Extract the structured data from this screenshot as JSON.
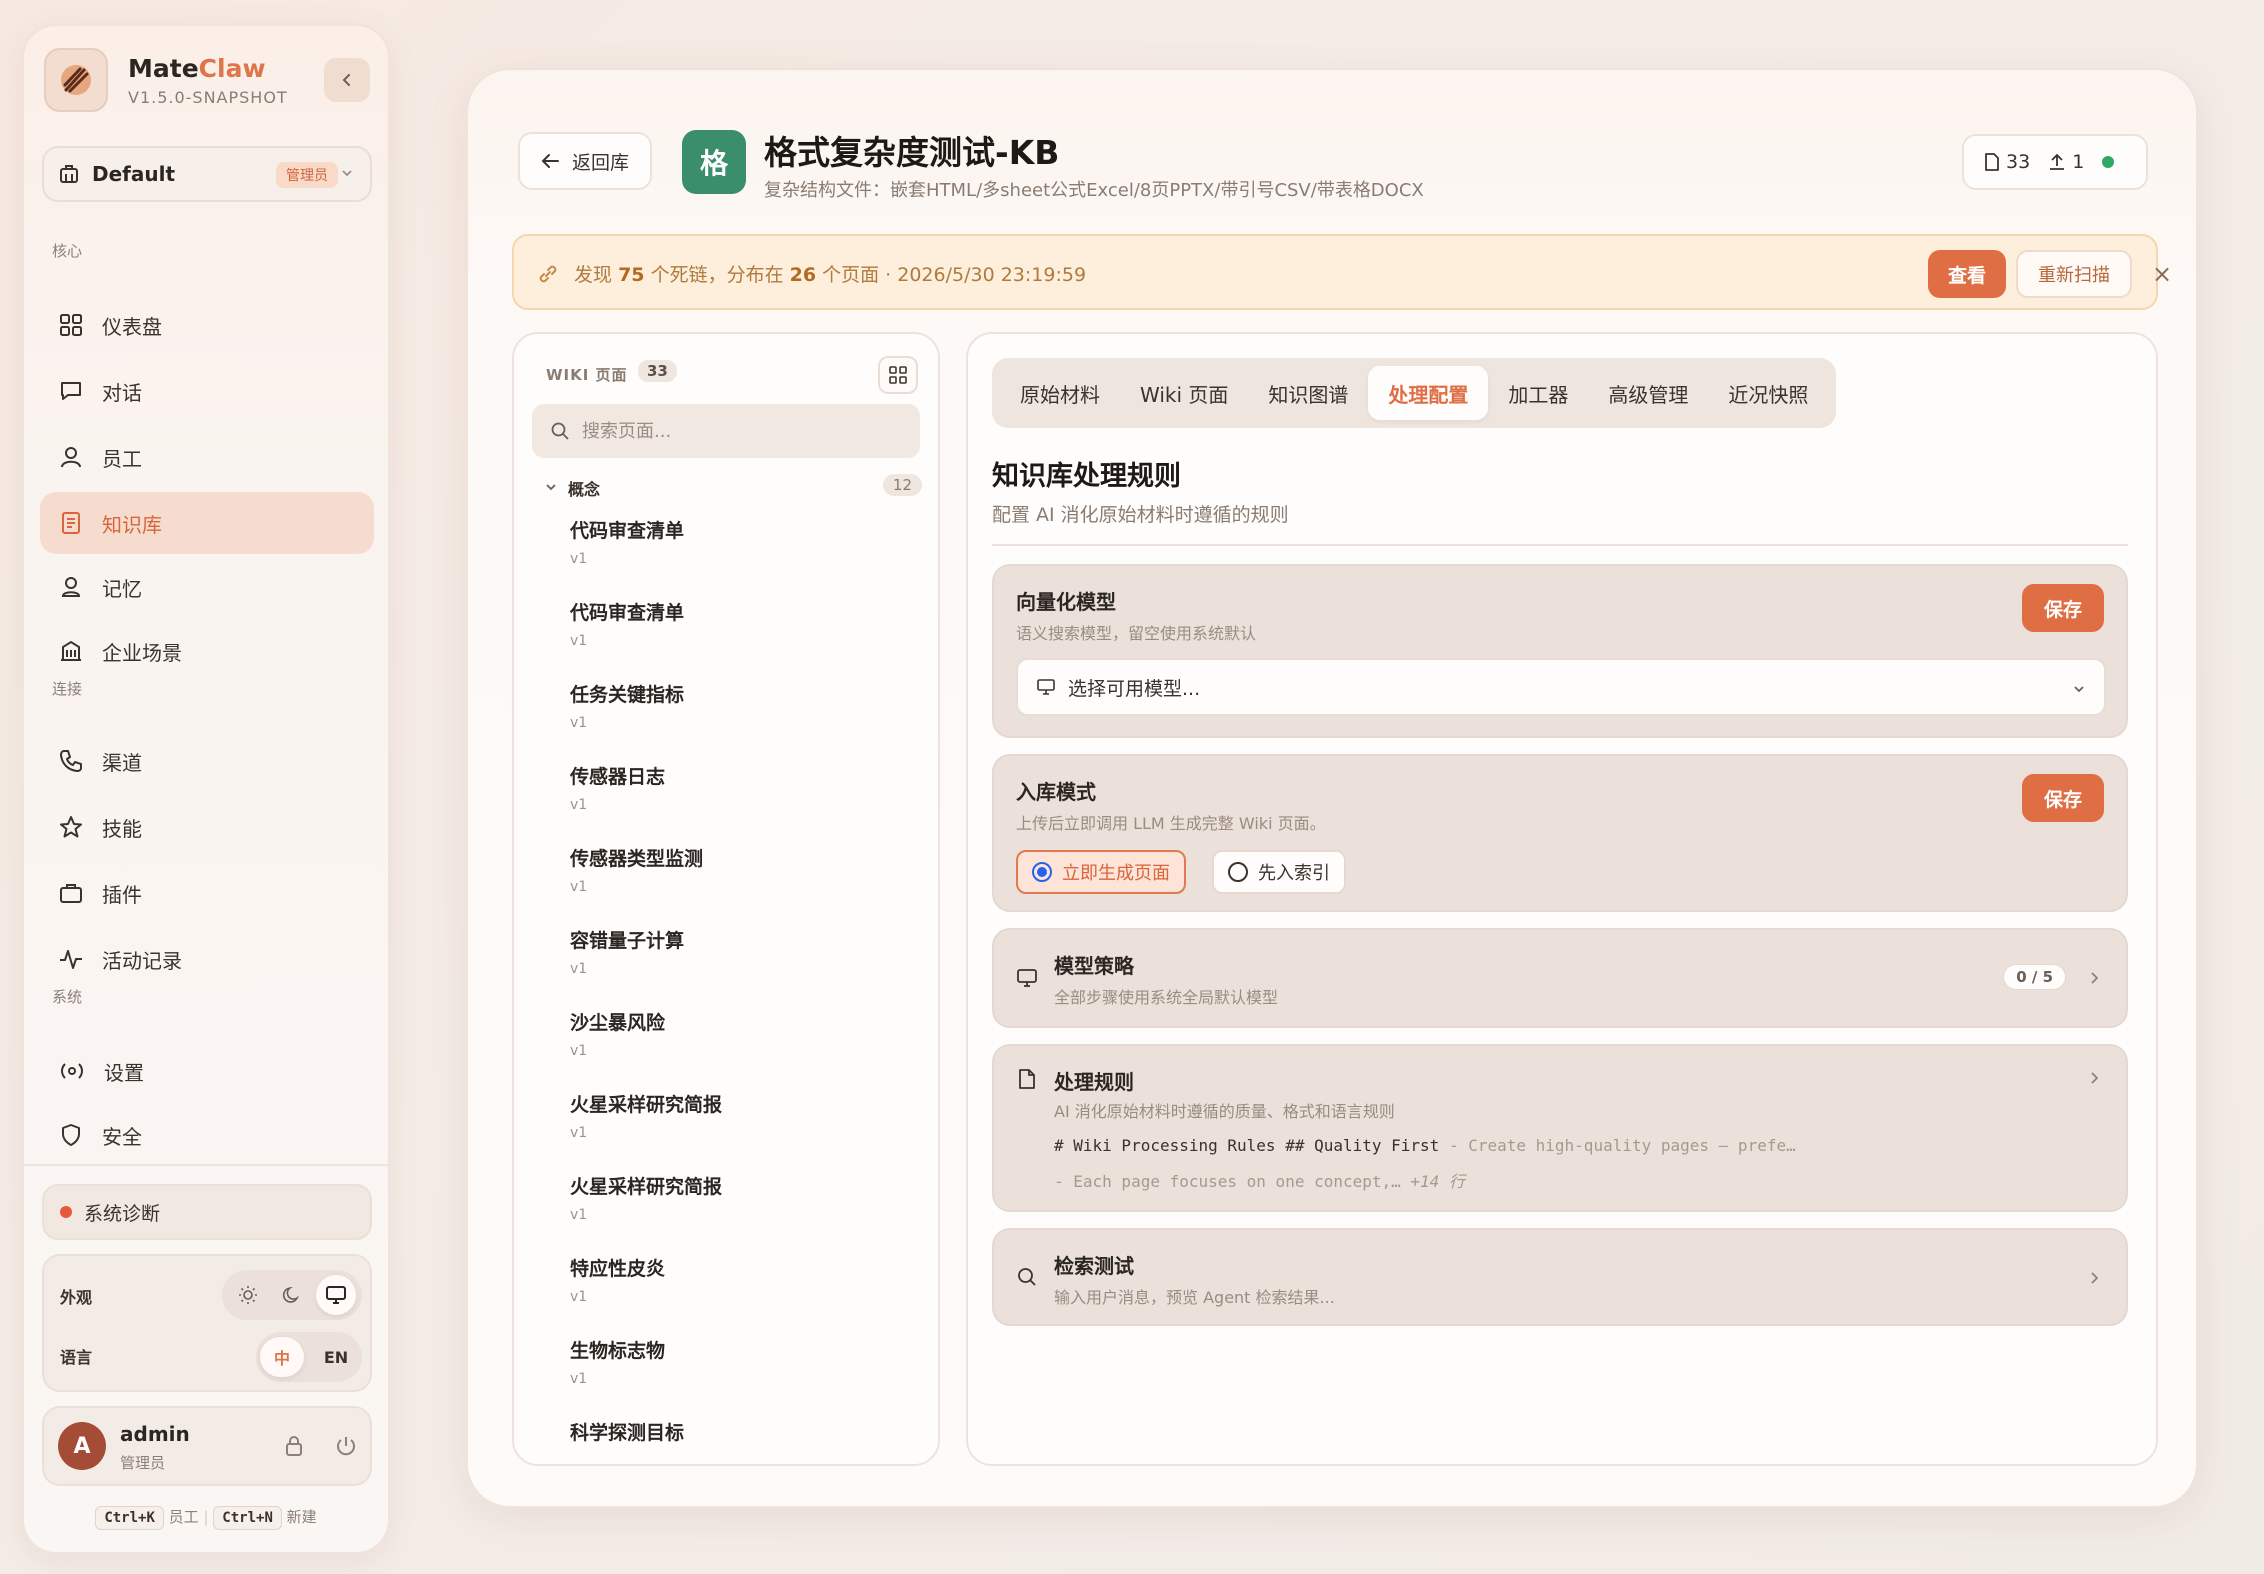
{
  "sidebar": {
    "brand_part1": "Mate",
    "brand_part2": "Claw",
    "version": "V1.5.0-SNAPSHOT",
    "workspace": {
      "name": "Default",
      "badge": "管理员"
    },
    "sections": {
      "core": "核心",
      "connect": "连接",
      "system": "系统"
    },
    "items": [
      {
        "label": "仪表盘",
        "icon": "grid-icon"
      },
      {
        "label": "对话",
        "icon": "chat-icon"
      },
      {
        "label": "员工",
        "icon": "user-icon"
      },
      {
        "label": "知识库",
        "icon": "document-icon",
        "active": true
      },
      {
        "label": "记忆",
        "icon": "memory-icon"
      },
      {
        "label": "企业场景",
        "icon": "building-icon"
      },
      {
        "label": "渠道",
        "icon": "phone-icon"
      },
      {
        "label": "技能",
        "icon": "star-icon"
      },
      {
        "label": "插件",
        "icon": "briefcase-icon"
      },
      {
        "label": "活动记录",
        "icon": "activity-icon"
      },
      {
        "label": "设置",
        "icon": "settings-icon"
      },
      {
        "label": "安全",
        "icon": "shield-icon"
      }
    ],
    "diagnostics": "系统诊断",
    "appearance_label": "外观",
    "language_label": "语言",
    "lang_zh": "中",
    "lang_en": "EN",
    "user": {
      "initial": "A",
      "name": "admin",
      "role": "管理员"
    },
    "shortcuts": [
      {
        "key": "Ctrl+K",
        "label": "员工"
      },
      {
        "key": "Ctrl+N",
        "label": "新建"
      }
    ]
  },
  "header": {
    "back_label": "返回库",
    "kb_initial": "格",
    "kb_title": "格式复杂度测试-KB",
    "kb_subtitle": "复杂结构文件：嵌套HTML/多sheet公式Excel/8页PPTX/带引号CSV/带表格DOCX",
    "stats": {
      "pages": "33",
      "uploads": "1"
    }
  },
  "alert": {
    "prefix": "发现",
    "dead_links": "75",
    "mid": "个死链，分布在",
    "pages": "26",
    "suffix": "个页面 · 2026/5/30 23:19:59",
    "view_label": "查看",
    "rescan_label": "重新扫描",
    "close": "×"
  },
  "wiki": {
    "heading": "WIKI 页面",
    "count": "33",
    "search_placeholder": "搜索页面...",
    "category": {
      "label": "概念",
      "count": "12"
    },
    "items": [
      {
        "title": "代码审查清单",
        "version": "v1"
      },
      {
        "title": "代码审查清单",
        "version": "v1"
      },
      {
        "title": "任务关键指标",
        "version": "v1"
      },
      {
        "title": "传感器日志",
        "version": "v1"
      },
      {
        "title": "传感器类型监测",
        "version": "v1"
      },
      {
        "title": "容错量子计算",
        "version": "v1"
      },
      {
        "title": "沙尘暴风险",
        "version": "v1"
      },
      {
        "title": "火星采样研究简报",
        "version": "v1"
      },
      {
        "title": "火星采样研究简报",
        "version": "v1"
      },
      {
        "title": "特应性皮炎",
        "version": "v1"
      },
      {
        "title": "生物标志物",
        "version": "v1"
      },
      {
        "title": "科学探测目标",
        "version": ""
      }
    ]
  },
  "config": {
    "tabs": [
      "原始材料",
      "Wiki 页面",
      "知识图谱",
      "处理配置",
      "加工器",
      "高级管理",
      "近况快照"
    ],
    "active_tab": 3,
    "title": "知识库处理规则",
    "subtitle": "配置 AI 消化原始材料时遵循的规则",
    "save_label": "保存",
    "vector": {
      "title": "向量化模型",
      "desc": "语义搜索模型，留空使用系统默认",
      "placeholder": "选择可用模型..."
    },
    "ingest": {
      "title": "入库模式",
      "desc": "上传后立即调用 LLM 生成完整 Wiki 页面。",
      "option_immediate": "立即生成页面",
      "option_index": "先入索引"
    },
    "strategy": {
      "title": "模型策略",
      "desc": "全部步骤使用系统全局默认模型",
      "ratio": "0 / 5"
    },
    "rules": {
      "title": "处理规则",
      "desc": "AI 消化原始材料时遵循的质量、格式和语言规则",
      "line1_code": "# Wiki Processing Rules ## Quality First",
      "line1_rest": " - Create high-quality pages — prefe…",
      "line2_code": "- Each page focuses on one concept,…",
      "line2_more": " +14 行"
    },
    "search_test": {
      "title": "检索测试",
      "desc": "输入用户消息，预览 Agent 检索结果..."
    }
  },
  "colors": {
    "accent": "#df6e44",
    "kb_icon": "#3a8e6c",
    "status_ok": "#2fa866",
    "diag_dot": "#e55a3a"
  }
}
